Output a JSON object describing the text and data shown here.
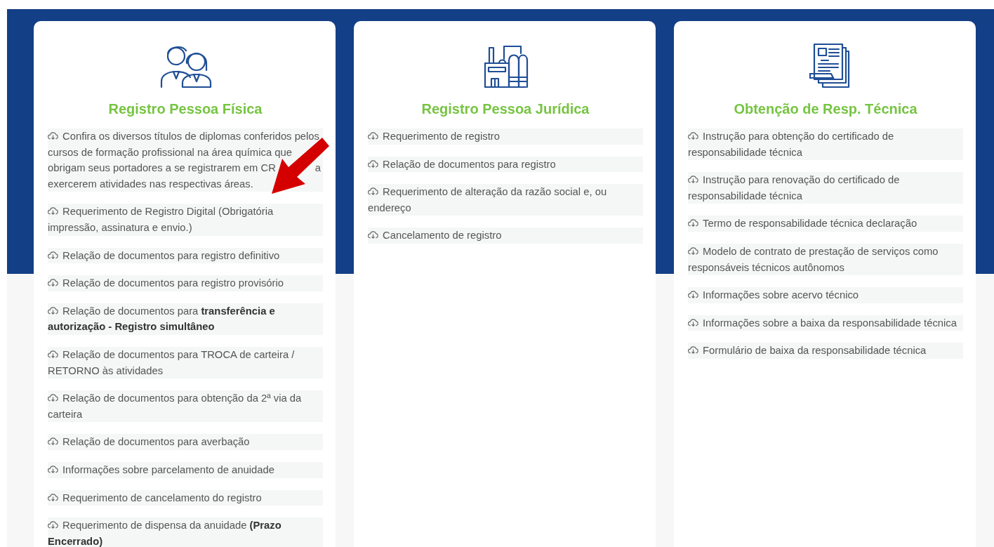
{
  "cards": [
    {
      "title": "Registro Pessoa Física",
      "items": [
        {
          "text": "Confira os diversos títulos de diplomas conferidos pelos cursos de formação profissional na área química que obrigam seus portadores a se registrarem em CR",
          "after_arrow": "a exercerem atividades nas respectivas áreas."
        },
        {
          "text": "Requerimento de Registro Digital (Obrigatória impressão, assinatura e envio.)"
        },
        {
          "text": "Relação de documentos para registro definitivo"
        },
        {
          "text": "Relação de documentos para registro provisório"
        },
        {
          "text": "Relação de documentos para **transferência e autorização - Registro simultâneo**"
        },
        {
          "text": "Relação de documentos para TROCA de carteira / RETORNO às atividades"
        },
        {
          "text": "Relação de documentos para obtenção da 2ª via da carteira"
        },
        {
          "text": "Relação de documentos para averbação"
        },
        {
          "text": "Informações sobre parcelamento de anuidade"
        },
        {
          "text": "Requerimento de cancelamento do registro"
        },
        {
          "text": "Requerimento de dispensa da anuidade **(Prazo Encerrado)**"
        }
      ]
    },
    {
      "title": "Registro Pessoa Jurídica",
      "items": [
        {
          "text": "Requerimento de registro"
        },
        {
          "text": "Relação de documentos para registro"
        },
        {
          "text": "Requerimento de alteração da razão social e, ou endereço"
        },
        {
          "text": "Cancelamento de registro"
        }
      ]
    },
    {
      "title": "Obtenção de Resp. Técnica",
      "items": [
        {
          "text": "Instrução para obtenção do certificado de responsabilidade técnica"
        },
        {
          "text": "Instrução para renovação do certificado de responsabilidade técnica"
        },
        {
          "text": "Termo de responsabilidade técnica declaração"
        },
        {
          "text": "Modelo de contrato de prestação de serviços como responsáveis técnicos autônomos"
        },
        {
          "text": "Informações sobre acervo técnico"
        },
        {
          "text": "Informações sobre a baixa da responsabilidade técnica"
        },
        {
          "text": "Formulário de baixa da responsabilidade técnica"
        }
      ]
    }
  ]
}
